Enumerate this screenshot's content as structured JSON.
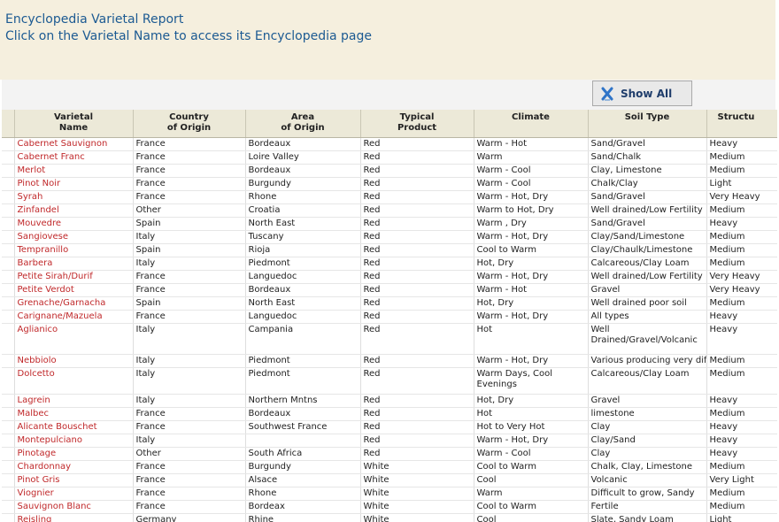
{
  "header": {
    "title": "Encyclopedia Varietal Report",
    "subtitle": "Click on the Varietal Name to access its Encyclopedia page"
  },
  "toolbar": {
    "show_all_label": "Show All",
    "show_all_icon": "clear-filter-x-icon"
  },
  "columns": [
    {
      "line1": "Varietal",
      "line2": "Name"
    },
    {
      "line1": "Country",
      "line2": "of Origin"
    },
    {
      "line1": "Area",
      "line2": "of Origin"
    },
    {
      "line1": "Typical",
      "line2": "Product"
    },
    {
      "line1": "Climate",
      "line2": ""
    },
    {
      "line1": "Soil Type",
      "line2": ""
    },
    {
      "line1": "Structu",
      "line2": ""
    }
  ],
  "rows": [
    {
      "name": "Cabernet Sauvignon",
      "country": "France",
      "area": "Bordeaux",
      "product": "Red",
      "climate": "Warm - Hot",
      "soil": "Sand/Gravel",
      "structure": "Heavy"
    },
    {
      "name": "Cabernet Franc",
      "country": "France",
      "area": "Loire Valley",
      "product": "Red",
      "climate": "Warm",
      "soil": "Sand/Chalk",
      "structure": "Medium"
    },
    {
      "name": "Merlot",
      "country": "France",
      "area": "Bordeaux",
      "product": "Red",
      "climate": "Warm - Cool",
      "soil": "Clay, Limestone",
      "structure": "Medium"
    },
    {
      "name": "Pinot Noir",
      "country": "France",
      "area": "Burgundy",
      "product": "Red",
      "climate": "Warm - Cool",
      "soil": "Chalk/Clay",
      "structure": "Light"
    },
    {
      "name": "Syrah",
      "country": "France",
      "area": "Rhone",
      "product": "Red",
      "climate": "Warm - Hot, Dry",
      "soil": "Sand/Gravel",
      "structure": "Very Heavy"
    },
    {
      "name": "Zinfandel",
      "country": "Other",
      "area": "Croatia",
      "product": "Red",
      "climate": "Warm to Hot, Dry",
      "soil": "Well drained/Low Fertility",
      "structure": "Medium"
    },
    {
      "name": "Mouvedre",
      "country": "Spain",
      "area": "North East",
      "product": "Red",
      "climate": "Warm , Dry",
      "soil": "Sand/Gravel",
      "structure": "Heavy"
    },
    {
      "name": "Sangiovese",
      "country": "Italy",
      "area": "Tuscany",
      "product": "Red",
      "climate": "Warm - Hot, Dry",
      "soil": "Clay/Sand/Limestone",
      "structure": "Medium"
    },
    {
      "name": "Tempranillo",
      "country": "Spain",
      "area": "Rioja",
      "product": "Red",
      "climate": "Cool to Warm",
      "soil": "Clay/Chaulk/Limestone",
      "structure": "Medium"
    },
    {
      "name": "Barbera",
      "country": "Italy",
      "area": "Piedmont",
      "product": "Red",
      "climate": "Hot, Dry",
      "soil": "Calcareous/Clay Loam",
      "structure": "Medium"
    },
    {
      "name": "Petite Sirah/Durif",
      "country": "France",
      "area": "Languedoc",
      "product": "Red",
      "climate": "Warm - Hot, Dry",
      "soil": "Well drained/Low Fertility",
      "structure": "Very Heavy"
    },
    {
      "name": "Petite Verdot",
      "country": "France",
      "area": "Bordeaux",
      "product": "Red",
      "climate": "Warm - Hot",
      "soil": "Gravel",
      "structure": "Very Heavy"
    },
    {
      "name": "Grenache/Garnacha",
      "country": "Spain",
      "area": "North East",
      "product": "Red",
      "climate": "Hot, Dry",
      "soil": "Well drained poor soil",
      "structure": "Medium"
    },
    {
      "name": "Carignane/Mazuela",
      "country": "France",
      "area": "Languedoc",
      "product": "Red",
      "climate": "Warm - Hot, Dry",
      "soil": "All types",
      "structure": "Heavy"
    },
    {
      "name": "Aglianico",
      "country": "Italy",
      "area": "Campania",
      "product": "Red",
      "climate": "Hot",
      "soil": "Well Drained/Gravel/Volcanic",
      "structure": "Heavy"
    },
    {
      "name": "Nebbiolo",
      "country": "Italy",
      "area": "Piedmont",
      "product": "Red",
      "climate": "Warm - Hot, Dry",
      "soil": "Various producing very diff",
      "structure": "Medium"
    },
    {
      "name": "Dolcetto",
      "country": "Italy",
      "area": "Piedmont",
      "product": "Red",
      "climate": "Warm Days, Cool Evenings",
      "soil": "Calcareous/Clay Loam",
      "structure": "Medium"
    },
    {
      "name": "Lagrein",
      "country": "Italy",
      "area": "Northern Mntns",
      "product": "Red",
      "climate": "Hot, Dry",
      "soil": "Gravel",
      "structure": "Heavy"
    },
    {
      "name": "Malbec",
      "country": "France",
      "area": "Bordeaux",
      "product": "Red",
      "climate": "Hot",
      "soil": "limestone",
      "structure": "Medium"
    },
    {
      "name": "Alicante Bouschet",
      "country": "France",
      "area": "Southwest France",
      "product": "Red",
      "climate": "Hot to Very Hot",
      "soil": "Clay",
      "structure": "Heavy"
    },
    {
      "name": "Montepulciano",
      "country": "Italy",
      "area": "",
      "product": "Red",
      "climate": "Warm - Hot, Dry",
      "soil": "Clay/Sand",
      "structure": "Heavy"
    },
    {
      "name": "Pinotage",
      "country": "Other",
      "area": "South Africa",
      "product": "Red",
      "climate": "Warm - Cool",
      "soil": "Clay",
      "structure": "Heavy"
    },
    {
      "name": "Chardonnay",
      "country": "France",
      "area": "Burgundy",
      "product": "White",
      "climate": "Cool to Warm",
      "soil": "Chalk, Clay, Limestone",
      "structure": "Medium"
    },
    {
      "name": "Pinot Gris",
      "country": "France",
      "area": "Alsace",
      "product": "White",
      "climate": "Cool",
      "soil": "Volcanic",
      "structure": "Very Light"
    },
    {
      "name": "Viognier",
      "country": "France",
      "area": "Rhone",
      "product": "White",
      "climate": "Warm",
      "soil": "Difficult to grow, Sandy",
      "structure": "Medium"
    },
    {
      "name": "Sauvignon Blanc",
      "country": "France",
      "area": "Bordeax",
      "product": "White",
      "climate": "Cool to Warm",
      "soil": "Fertile",
      "structure": "Medium"
    },
    {
      "name": "Reisling",
      "country": "Germany",
      "area": "Rhine",
      "product": "White",
      "climate": "Cool",
      "soil": "Slate, Sandy Loam",
      "structure": "Light"
    }
  ]
}
